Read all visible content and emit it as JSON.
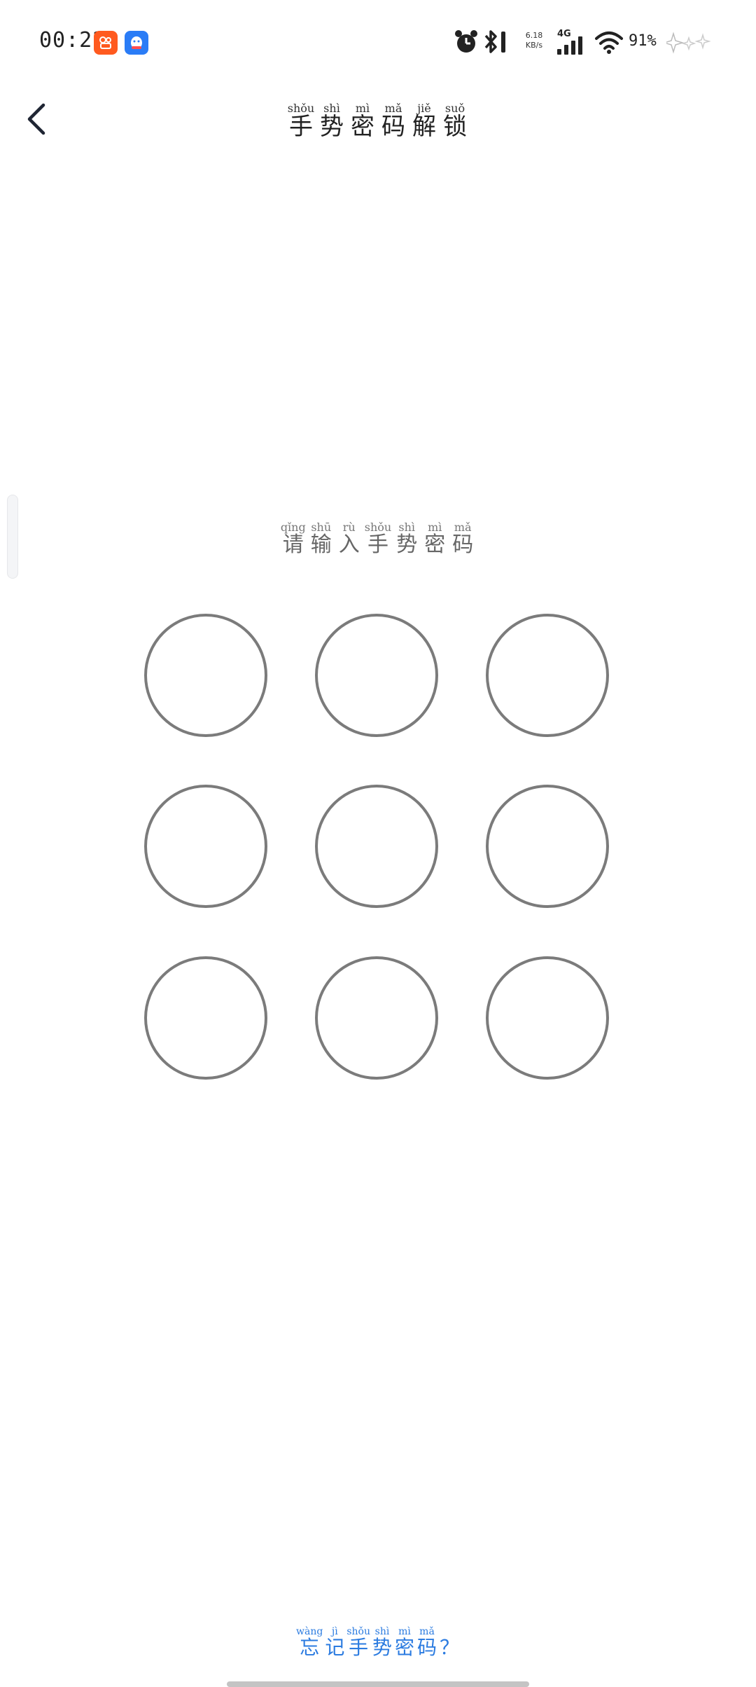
{
  "status_bar": {
    "time": "00:22",
    "network_speed_value": "6.18",
    "network_speed_unit": "KB/s",
    "network_type": "4G",
    "battery": "91%",
    "icons": [
      "kuaishou-app-icon",
      "qq-app-icon",
      "alarm-icon",
      "bluetooth-icon",
      "signal-icon",
      "wifi-icon",
      "sparkle-icon"
    ]
  },
  "header": {
    "back_icon": "chevron-left-icon",
    "title": [
      {
        "py": "shǒu",
        "hz": "手"
      },
      {
        "py": "shì",
        "hz": "势"
      },
      {
        "py": "mì",
        "hz": "密"
      },
      {
        "py": "mǎ",
        "hz": "码"
      },
      {
        "py": "jiě",
        "hz": "解"
      },
      {
        "py": "suǒ",
        "hz": "锁"
      }
    ]
  },
  "prompt": [
    {
      "py": "qǐng",
      "hz": "请"
    },
    {
      "py": "shū",
      "hz": "输"
    },
    {
      "py": "rù",
      "hz": "入"
    },
    {
      "py": "shǒu",
      "hz": "手"
    },
    {
      "py": "shì",
      "hz": "势"
    },
    {
      "py": "mì",
      "hz": "密"
    },
    {
      "py": "mǎ",
      "hz": "码"
    }
  ],
  "pattern": {
    "rows": 3,
    "cols": 3,
    "ring_color": "#7b7b7b"
  },
  "forgot_link": [
    {
      "py": "wàng",
      "hz": "忘"
    },
    {
      "py": "jì",
      "hz": "记"
    },
    {
      "py": "shǒu",
      "hz": "手"
    },
    {
      "py": "shì",
      "hz": "势"
    },
    {
      "py": "mì",
      "hz": "密"
    },
    {
      "py": "mǎ",
      "hz": "码"
    },
    {
      "py": "",
      "hz": "？"
    }
  ],
  "colors": {
    "link": "#2b7be0",
    "title_text": "#222222",
    "prompt_text": "#666666",
    "background": "#ffffff"
  }
}
